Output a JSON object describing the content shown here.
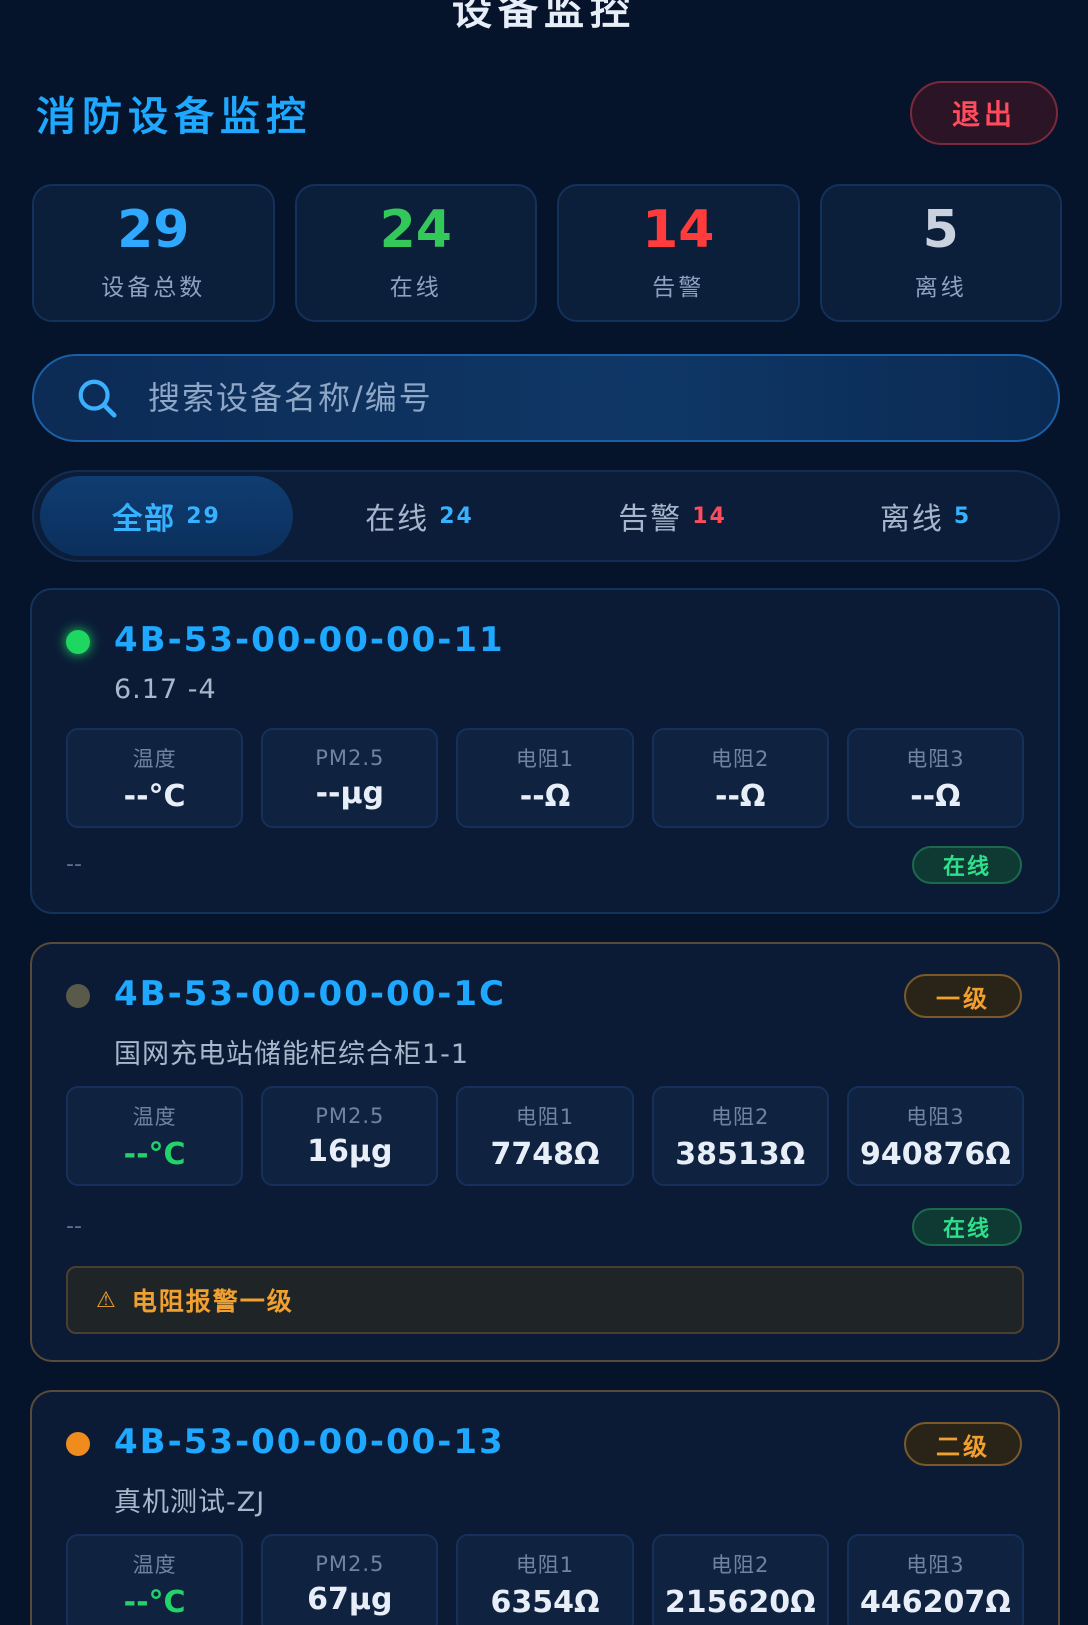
{
  "header": {
    "top_title": "设备监控",
    "app_title": "消防设备监控",
    "logout_label": "退出"
  },
  "stats": [
    {
      "value": "29",
      "label": "设备总数",
      "color": "#2fa8ff"
    },
    {
      "value": "24",
      "label": "在线",
      "color": "#34c759"
    },
    {
      "value": "14",
      "label": "告警",
      "color": "#ff3b3b"
    },
    {
      "value": "5",
      "label": "离线",
      "color": "#c9d2de"
    }
  ],
  "search": {
    "placeholder": "搜索设备名称/编号",
    "icon": "search-icon"
  },
  "tabs": [
    {
      "label": "全部",
      "count": "29",
      "count_color": "#36b2ff"
    },
    {
      "label": "在线",
      "count": "24",
      "count_color": "#36b2ff"
    },
    {
      "label": "告警",
      "count": "14",
      "count_color": "#ff4b5c"
    },
    {
      "label": "离线",
      "count": "5",
      "count_color": "#36b2ff"
    }
  ],
  "devices": [
    {
      "id": "4B-53-00-00-00-11",
      "name": "6.17 -4",
      "status_dot_color": "#1ed760",
      "level": "",
      "metrics": [
        {
          "label": "温度",
          "value": "--°C"
        },
        {
          "label": "PM2.5",
          "value": "--μg"
        },
        {
          "label": "电阻1",
          "value": "--Ω"
        },
        {
          "label": "电阻2",
          "value": "--Ω"
        },
        {
          "label": "电阻3",
          "value": "--Ω"
        }
      ],
      "time": "--",
      "status": "在线",
      "alarm": ""
    },
    {
      "id": "4B-53-00-00-00-1C",
      "name": "国网充电站储能柜综合柜1-1",
      "status_dot_color": "#5a5a4a",
      "level": "一级",
      "metrics": [
        {
          "label": "温度",
          "value": "--°C"
        },
        {
          "label": "PM2.5",
          "value": "16μg"
        },
        {
          "label": "电阻1",
          "value": "7748Ω"
        },
        {
          "label": "电阻2",
          "value": "38513Ω"
        },
        {
          "label": "电阻3",
          "value": "940876Ω"
        }
      ],
      "time": "--",
      "status": "在线",
      "alarm": "电阻报警一级"
    },
    {
      "id": "4B-53-00-00-00-13",
      "name": "真机测试-ZJ",
      "status_dot_color": "#f08c1e",
      "level": "二级",
      "metrics": [
        {
          "label": "温度",
          "value": "--°C"
        },
        {
          "label": "PM2.5",
          "value": "67μg"
        },
        {
          "label": "电阻1",
          "value": "6354Ω"
        },
        {
          "label": "电阻2",
          "value": "215620Ω"
        },
        {
          "label": "电阻3",
          "value": "446207Ω"
        }
      ]
    }
  ]
}
